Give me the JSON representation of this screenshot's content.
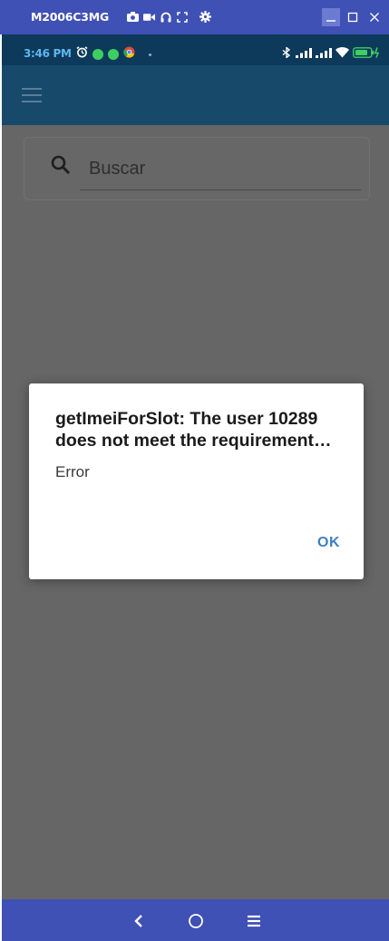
{
  "window": {
    "device_name": "M2006C3MG",
    "tool_icons": [
      "camera-icon",
      "video-icon",
      "headphones-icon",
      "fullscreen-icon",
      "settings-icon"
    ],
    "controls": [
      "minimize-icon",
      "maximize-icon",
      "close-icon"
    ]
  },
  "status_bar": {
    "time": "3:46 PM",
    "left_icons": [
      "alarm-icon",
      "app-notification-icon",
      "app-notification-icon",
      "chrome-icon"
    ],
    "right_icons": [
      "bluetooth-icon",
      "signal-icon",
      "signal-icon",
      "wifi-icon",
      "battery-charging-icon"
    ]
  },
  "app_bar": {
    "menu_icon": "hamburger-menu-icon"
  },
  "search": {
    "placeholder": "Buscar",
    "value": ""
  },
  "dialog": {
    "title": "getImeiForSlot: The user 10289 does not meet the requirement…",
    "message": "Error",
    "ok_label": "OK"
  },
  "nav_bar": {
    "buttons": [
      "back-icon",
      "home-icon",
      "recents-icon"
    ]
  },
  "colors": {
    "window_bar": "#3f51b5",
    "status_bar": "#0d3a5a",
    "app_bar": "#17496b",
    "scrim": "#666666",
    "accent": "#3f7fc2"
  }
}
